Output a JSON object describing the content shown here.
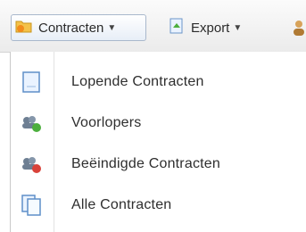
{
  "toolbar": {
    "contracten_label": "Contracten",
    "export_label": "Export"
  },
  "menu": {
    "items": [
      {
        "label": "Lopende Contracten",
        "icon": "document-icon"
      },
      {
        "label": "Voorlopers",
        "icon": "people-green-icon"
      },
      {
        "label": "Beëindigde Contracten",
        "icon": "people-red-icon"
      },
      {
        "label": "Alle Contracten",
        "icon": "documents-icon"
      }
    ]
  }
}
